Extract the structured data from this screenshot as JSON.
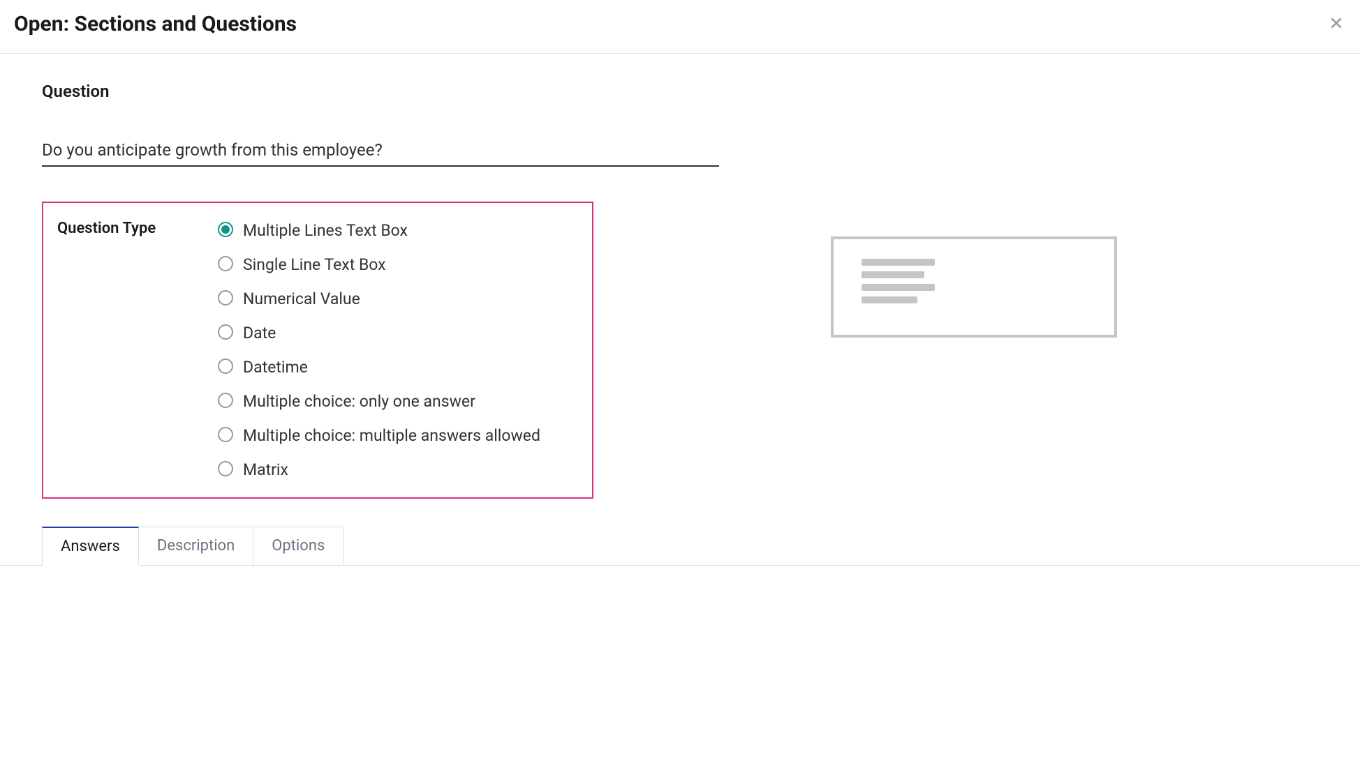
{
  "header": {
    "title": "Open: Sections and Questions"
  },
  "form": {
    "question_label": "Question",
    "question_value": "Do you anticipate growth from this employee?",
    "question_type_label": "Question Type",
    "question_types": [
      {
        "label": "Multiple Lines Text Box",
        "selected": true
      },
      {
        "label": "Single Line Text Box",
        "selected": false
      },
      {
        "label": "Numerical Value",
        "selected": false
      },
      {
        "label": "Date",
        "selected": false
      },
      {
        "label": "Datetime",
        "selected": false
      },
      {
        "label": "Multiple choice: only one answer",
        "selected": false
      },
      {
        "label": "Multiple choice: multiple answers allowed",
        "selected": false
      },
      {
        "label": "Matrix",
        "selected": false
      }
    ]
  },
  "tabs": [
    {
      "label": "Answers",
      "active": true
    },
    {
      "label": "Description",
      "active": false
    },
    {
      "label": "Options",
      "active": false
    }
  ]
}
